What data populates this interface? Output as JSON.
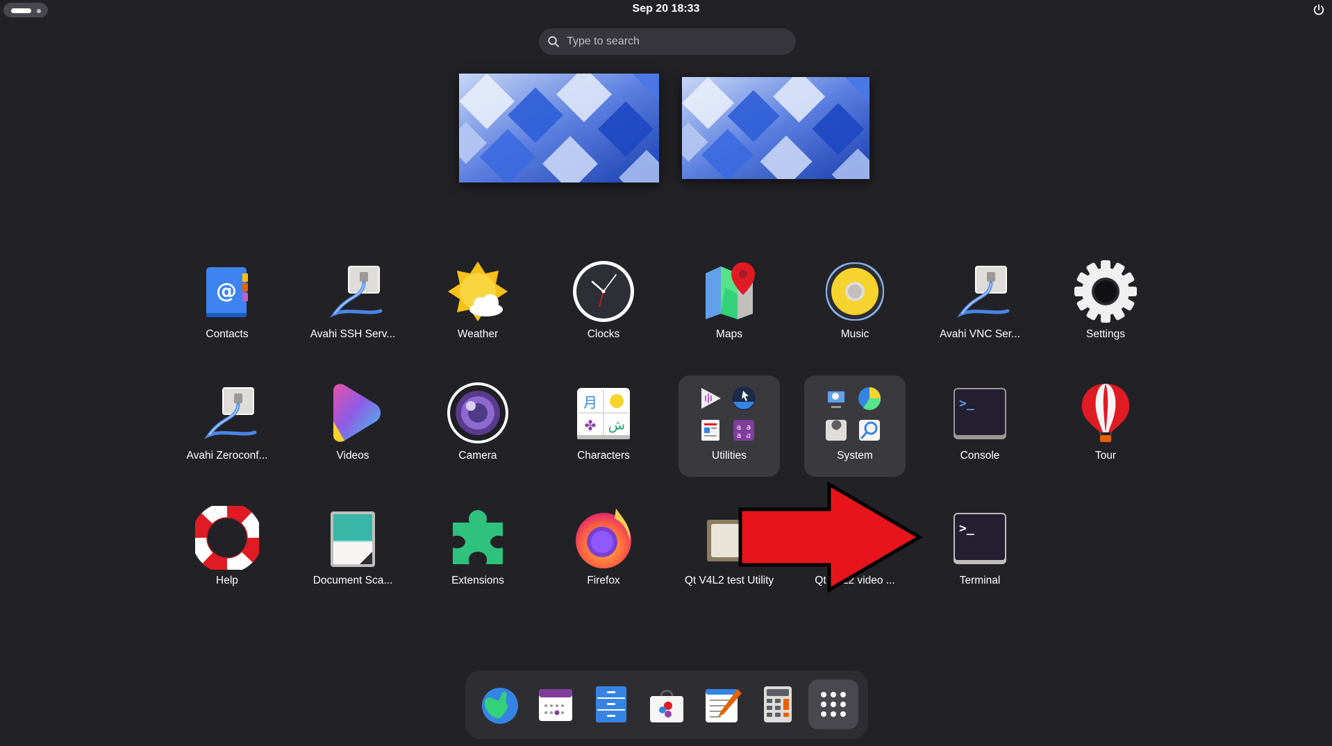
{
  "topbar": {
    "clock": "Sep 20  18:33"
  },
  "search": {
    "placeholder": "Type to search"
  },
  "apps": [
    {
      "label": "Contacts",
      "icon": "contacts-icon"
    },
    {
      "label": "Avahi SSH Serv...",
      "icon": "avahi-ssh-icon"
    },
    {
      "label": "Weather",
      "icon": "weather-icon"
    },
    {
      "label": "Clocks",
      "icon": "clocks-icon"
    },
    {
      "label": "Maps",
      "icon": "maps-icon"
    },
    {
      "label": "Music",
      "icon": "music-icon"
    },
    {
      "label": "Avahi VNC Ser...",
      "icon": "avahi-vnc-icon"
    },
    {
      "label": "Settings",
      "icon": "gear-icon"
    },
    {
      "label": "Avahi Zeroconf...",
      "icon": "avahi-zeroconf-icon"
    },
    {
      "label": "Videos",
      "icon": "videos-icon"
    },
    {
      "label": "Camera",
      "icon": "camera-icon"
    },
    {
      "label": "Characters",
      "icon": "characters-icon"
    },
    {
      "label": "Utilities",
      "icon": "folder-icon"
    },
    {
      "label": "System",
      "icon": "folder-icon"
    },
    {
      "label": "Console",
      "icon": "console-icon"
    },
    {
      "label": "Tour",
      "icon": "balloon-icon"
    },
    {
      "label": "Help",
      "icon": "lifebuoy-icon"
    },
    {
      "label": "Document Sca...",
      "icon": "scanner-icon"
    },
    {
      "label": "Extensions",
      "icon": "puzzle-icon"
    },
    {
      "label": "Firefox",
      "icon": "firefox-icon"
    },
    {
      "label": "Qt V4L2 test Utility",
      "icon": "qt-v4l2-icon"
    },
    {
      "label": "Qt V4L2 video ...",
      "icon": "qt-video-icon"
    },
    {
      "label": "Terminal",
      "icon": "terminal-icon"
    }
  ],
  "dock": [
    {
      "name": "web-browser",
      "icon": "globe-icon"
    },
    {
      "name": "calendar",
      "icon": "calendar-icon"
    },
    {
      "name": "files",
      "icon": "file-cabinet-icon"
    },
    {
      "name": "software",
      "icon": "shopping-bag-icon"
    },
    {
      "name": "text-editor",
      "icon": "text-editor-icon"
    },
    {
      "name": "calculator",
      "icon": "calculator-icon"
    },
    {
      "name": "show-apps",
      "icon": "app-grid-icon"
    }
  ],
  "colors": {
    "background": "#222226",
    "folder": "#3a3a3e",
    "dock": "#2e2e32",
    "arrow": "#e8141c"
  }
}
